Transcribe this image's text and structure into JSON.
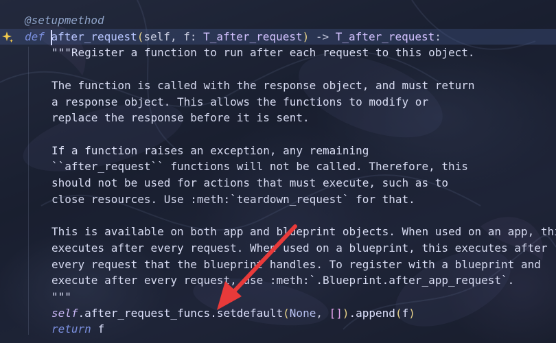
{
  "editor": {
    "lines": [
      {
        "tokens": [
          {
            "c": "dec",
            "t": "@setupmethod"
          }
        ],
        "indent": 36
      },
      {
        "tokens": [
          {
            "c": "kw",
            "t": "def "
          },
          {
            "c": "fn",
            "t": "after_request"
          },
          {
            "c": "paren",
            "t": "("
          },
          {
            "c": "param",
            "t": "self, f: "
          },
          {
            "c": "type",
            "t": "T_after_request"
          },
          {
            "c": "paren",
            "t": ")"
          },
          {
            "c": "punc",
            "t": " -> "
          },
          {
            "c": "type",
            "t": "T_after_request"
          },
          {
            "c": "punc",
            "t": ":"
          }
        ],
        "indent": 36,
        "current": true
      },
      {
        "tokens": [
          {
            "c": "doc",
            "t": "\"\"\"Register a function to run after each request to this object."
          }
        ],
        "indent": 75
      },
      {
        "tokens": [],
        "indent": 75
      },
      {
        "tokens": [
          {
            "c": "doc",
            "t": "The function is called with the response object, and must return"
          }
        ],
        "indent": 75
      },
      {
        "tokens": [
          {
            "c": "doc",
            "t": "a response object. This allows the functions to modify or"
          }
        ],
        "indent": 75
      },
      {
        "tokens": [
          {
            "c": "doc",
            "t": "replace the response before it is sent."
          }
        ],
        "indent": 75
      },
      {
        "tokens": [],
        "indent": 75
      },
      {
        "tokens": [
          {
            "c": "doc",
            "t": "If a function raises an exception, any remaining"
          }
        ],
        "indent": 75
      },
      {
        "tokens": [
          {
            "c": "doc",
            "t": "``after_request`` functions will not be called. Therefore, this"
          }
        ],
        "indent": 75
      },
      {
        "tokens": [
          {
            "c": "doc",
            "t": "should not be used for actions that must execute, such as to"
          }
        ],
        "indent": 75
      },
      {
        "tokens": [
          {
            "c": "doc",
            "t": "close resources. Use :meth:`teardown_request` for that."
          }
        ],
        "indent": 75
      },
      {
        "tokens": [],
        "indent": 75
      },
      {
        "tokens": [
          {
            "c": "doc",
            "t": "This is available on both app and blueprint objects. When used on an app, thi"
          }
        ],
        "indent": 75
      },
      {
        "tokens": [
          {
            "c": "doc",
            "t": "executes after every request. When used on a blueprint, this executes after"
          }
        ],
        "indent": 75
      },
      {
        "tokens": [
          {
            "c": "doc",
            "t": "every request that the blueprint handles. To register with a blueprint and"
          }
        ],
        "indent": 75
      },
      {
        "tokens": [
          {
            "c": "doc",
            "t": "execute after every request, use :meth:`.Blueprint.after_app_request`."
          }
        ],
        "indent": 75
      },
      {
        "tokens": [
          {
            "c": "doc",
            "t": "\"\"\""
          }
        ],
        "indent": 75
      },
      {
        "tokens": [
          {
            "c": "self",
            "t": "self"
          },
          {
            "c": "call",
            "t": ".after_request_funcs.setdefault"
          },
          {
            "c": "paren",
            "t": "("
          },
          {
            "c": "none",
            "t": "None"
          },
          {
            "c": "punc",
            "t": ", "
          },
          {
            "c": "bracket",
            "t": "[]"
          },
          {
            "c": "paren",
            "t": ")"
          },
          {
            "c": "call",
            "t": ".append"
          },
          {
            "c": "paren",
            "t": "("
          },
          {
            "c": "call",
            "t": "f"
          },
          {
            "c": "paren",
            "t": ")"
          }
        ],
        "indent": 75
      },
      {
        "tokens": [
          {
            "c": "kw",
            "t": "return "
          },
          {
            "c": "call",
            "t": "f"
          }
        ],
        "indent": 75
      }
    ]
  },
  "gutter": {
    "icon": "sparkle-icon"
  },
  "annotation": {
    "icon": "red-arrow-icon",
    "color": "#e83a3a"
  }
}
